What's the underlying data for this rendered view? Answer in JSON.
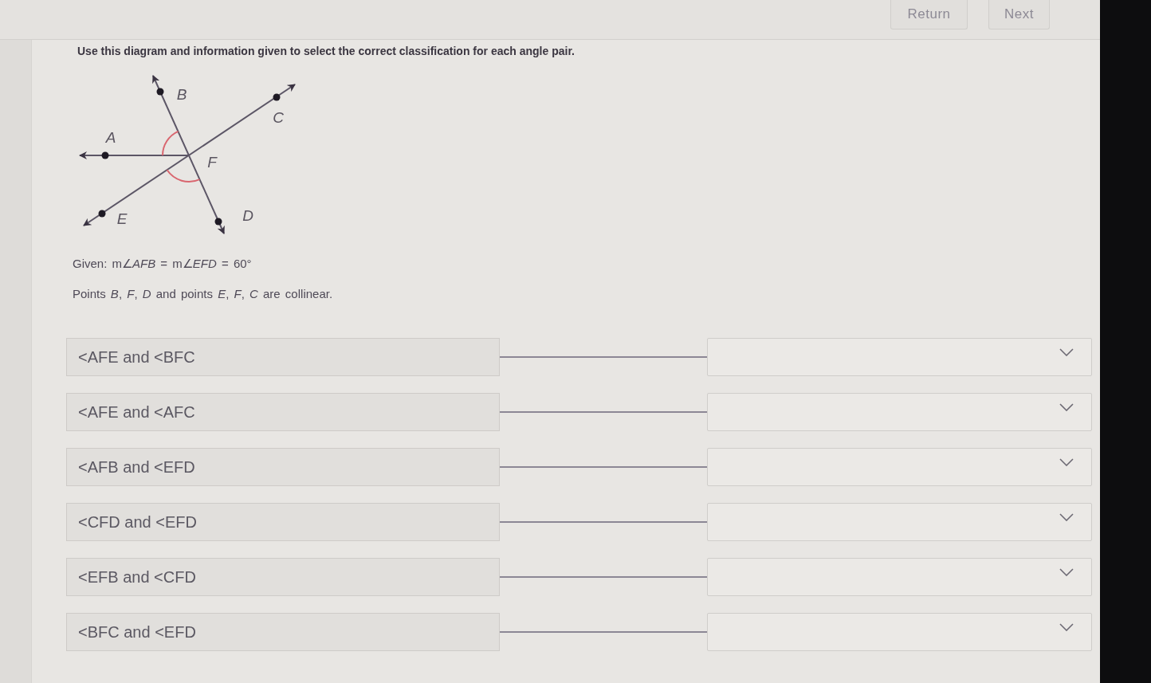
{
  "header": {
    "buttons": [
      {
        "label": "Return"
      },
      {
        "label": "Next"
      }
    ]
  },
  "question": {
    "instructions": "Use this diagram and information given to select the correct classification for each angle pair.",
    "diagram": {
      "points": [
        {
          "label": "A"
        },
        {
          "label": "B"
        },
        {
          "label": "C"
        },
        {
          "label": "D"
        },
        {
          "label": "E"
        },
        {
          "label": "F"
        }
      ]
    },
    "given": "Given: m∠*AFB* = m∠*EFD* = 60°",
    "collinear_note": "Points *B*, *F*, *D* and points *E*, *F*, *C* are collinear."
  },
  "angle_pairs": [
    {
      "pair": "<AFE and <BFC"
    },
    {
      "pair": "<AFE and <AFC"
    },
    {
      "pair": "<AFB and <EFD"
    },
    {
      "pair": "<CFD and <EFD"
    },
    {
      "pair": "<EFB and <CFD"
    },
    {
      "pair": "<BFC and <EFD"
    }
  ]
}
